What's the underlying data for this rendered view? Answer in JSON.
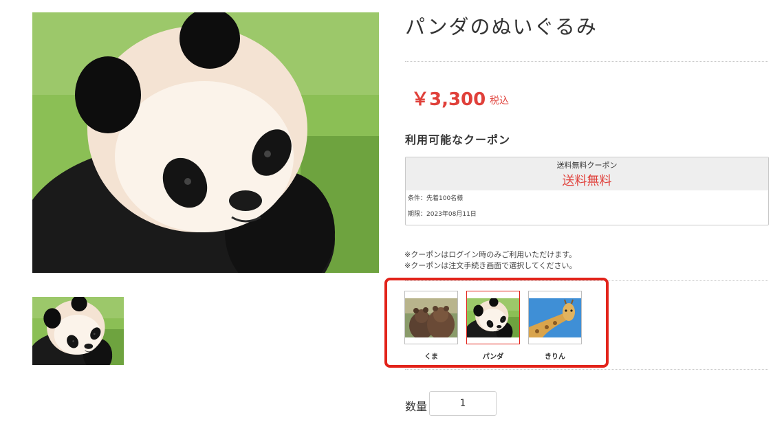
{
  "product": {
    "title": "パンダのぬいぐるみ",
    "price": "￥3,300",
    "tax_label": "税込"
  },
  "images": {
    "main": {
      "icon": "panda-photo"
    },
    "thumbnails": [
      {
        "icon": "panda-photo"
      }
    ]
  },
  "coupons": {
    "heading": "利用可能なクーポン",
    "items": [
      {
        "name": "送料無料クーポン",
        "value": "送料無料",
        "condition": "条件：先着100名様",
        "expiry": "期限：2023年08月11日"
      }
    ],
    "notes": [
      "※クーポンはログイン時のみご利用いただけます。",
      "※クーポンは注文手続き画面で選択してください。"
    ]
  },
  "variants": {
    "selected_index": 1,
    "items": [
      {
        "label": "くま",
        "icon": "bear-photo"
      },
      {
        "label": "パンダ",
        "icon": "panda-photo"
      },
      {
        "label": "きりん",
        "icon": "giraffe-photo"
      }
    ]
  },
  "quantity": {
    "label": "数量",
    "value": "1"
  },
  "colors": {
    "accent_red": "#e0403a",
    "highlight_frame": "#e2231a"
  }
}
